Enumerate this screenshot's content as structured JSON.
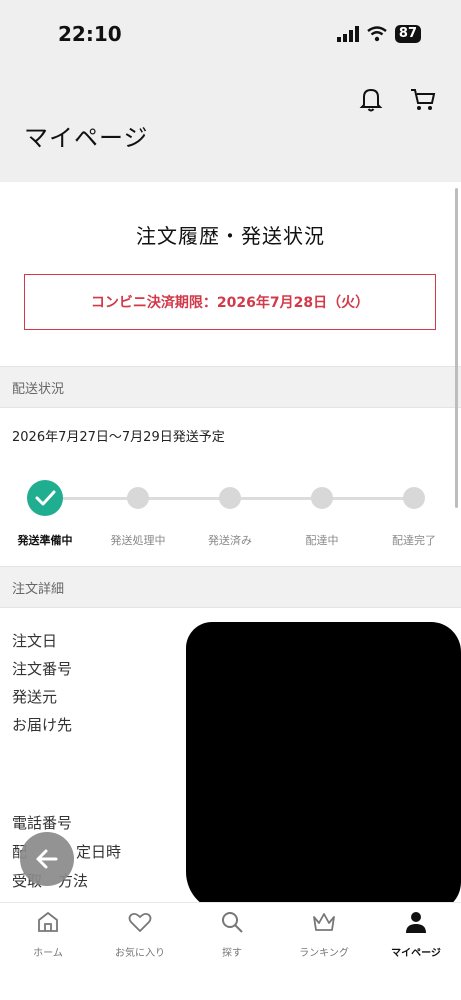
{
  "status_bar": {
    "time": "22:10",
    "battery": "87"
  },
  "header": {
    "title": "マイページ"
  },
  "page": {
    "heading": "注文履歴・発送状況",
    "notice": "コンビニ決済期限：2026年7月28日（火）"
  },
  "shipping": {
    "section_label": "配送状況",
    "estimate": "2026年7月27日〜7月29日発送予定",
    "steps": [
      "発送準備中",
      "発送処理中",
      "発送済み",
      "配達中",
      "配達完了"
    ],
    "current_step_index": 0
  },
  "order_details": {
    "section_label": "注文詳細",
    "fields": [
      "注文日",
      "注文番号",
      "発送元",
      "お届け先",
      "電話番号",
      "配",
      "定日時",
      "受取",
      "方法"
    ],
    "colon": ":"
  },
  "tabbar": {
    "items": [
      {
        "label": "ホーム",
        "icon": "home-icon"
      },
      {
        "label": "お気に入り",
        "icon": "heart-icon"
      },
      {
        "label": "探す",
        "icon": "search-icon"
      },
      {
        "label": "ランキング",
        "icon": "crown-icon"
      },
      {
        "label": "マイページ",
        "icon": "person-icon"
      }
    ],
    "active_index": 4
  },
  "colors": {
    "accent_red": "#d23a4a",
    "accent_green": "#1fae8f"
  }
}
